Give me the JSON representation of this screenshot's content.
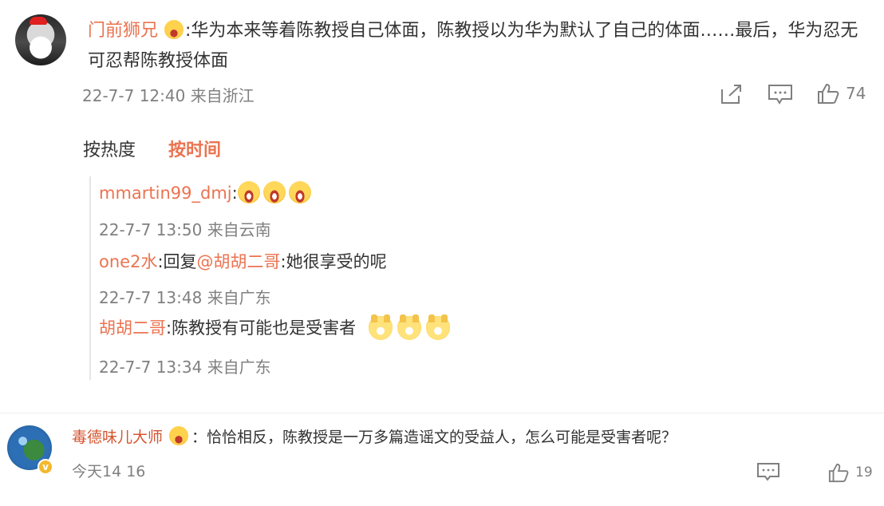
{
  "comment_main": {
    "username": "门前狮兄",
    "text": ":华为本来等着陈教授自己体面，陈教授以为华为默认了自己的体面……最后，华为忍无可忍帮陈教授体面",
    "timestamp": "22-7-7 12:40",
    "location": "来自浙江",
    "like_count": "74"
  },
  "sort_tabs": {
    "hot_label": "按热度",
    "time_label": "按时间"
  },
  "replies": [
    {
      "username": "mmartin99_dmj",
      "text": ":",
      "timestamp": "22-7-7 13:50",
      "location": "来自云南"
    },
    {
      "username": "one2水",
      "prefix": ":回复",
      "mention": "@胡胡二哥",
      "text": ":她很享受的呢",
      "timestamp": "22-7-7 13:48",
      "location": "来自广东"
    },
    {
      "username": "胡胡二哥",
      "text": ":陈教授有可能也是受害者",
      "timestamp": "22-7-7 13:34",
      "location": "来自广东"
    }
  ],
  "comment_second": {
    "username": "毒德味儿大师",
    "text": "：恰恰相反，陈教授是一万多篇造谣文的受益人，怎么可能是受害者呢？",
    "timestamp": "今天14 16",
    "like_count": "19",
    "badge": "v"
  },
  "colors": {
    "username": "#eb7350",
    "meta": "#808080",
    "text": "#333333",
    "icon": "#7f7f7f"
  },
  "icons": {
    "share": "share-icon",
    "comment": "comment-icon",
    "like": "thumbs-up-icon",
    "emoji_laugh": "laughing-emoji-icon",
    "emoji_dog": "doge-emoji-icon",
    "user_badge": "face-badge-icon"
  }
}
